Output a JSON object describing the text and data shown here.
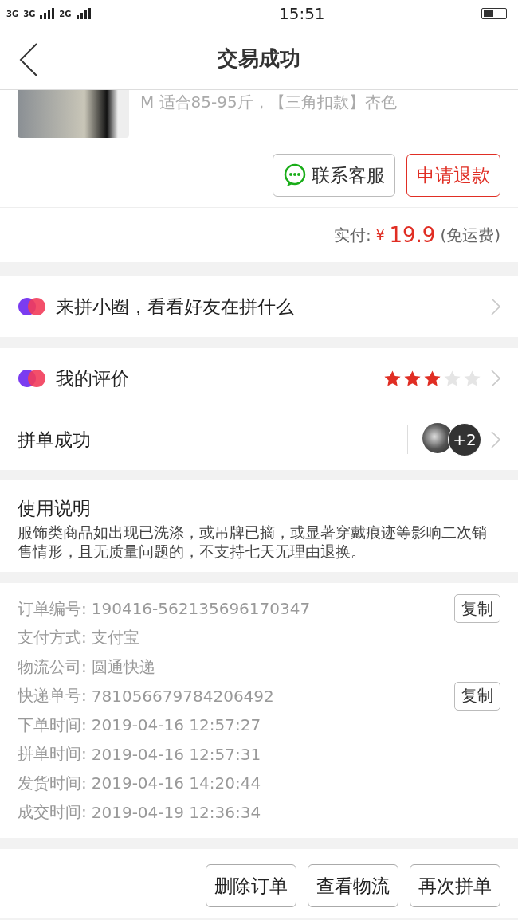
{
  "status_bar": {
    "network_1": "3G",
    "network_2": "3G",
    "network_3": "2G",
    "time": "15:51"
  },
  "header": {
    "title": "交易成功"
  },
  "product": {
    "spec": "M 适合85-95斤，【三角扣款】杏色"
  },
  "product_actions": [
    {
      "label": "联系客服",
      "kind": "chat"
    },
    {
      "label": "申请退款",
      "kind": "primary"
    }
  ],
  "payment": {
    "label": "实付:",
    "currency": "¥",
    "amount": "19.9",
    "note": "(免运费)"
  },
  "circle_row": {
    "label": "来拼小圈，看看好友在拼什么"
  },
  "review_row": {
    "label": "我的评价",
    "stars": 3
  },
  "group_row": {
    "label": "拼单成功",
    "extra_count": "+2"
  },
  "usage": {
    "title": "使用说明",
    "text": "服饰类商品如出现已洗涤，或吊牌已摘，或显著穿戴痕迹等影响二次销售情形，且无质量问题的，不支持七天无理由退换。"
  },
  "order_info": [
    {
      "label": "订单编号:",
      "value": "190416-562135696170347",
      "copy": "复制"
    },
    {
      "label": "支付方式:",
      "value": "支付宝"
    },
    {
      "label": "物流公司:",
      "value": "圆通快递"
    },
    {
      "label": "快递单号:",
      "value": "781056679784206492",
      "copy": "复制"
    },
    {
      "label": "下单时间:",
      "value": "2019-04-16 12:57:27"
    },
    {
      "label": "拼单时间:",
      "value": "2019-04-16 12:57:31"
    },
    {
      "label": "发货时间:",
      "value": "2019-04-16 14:20:44"
    },
    {
      "label": "成交时间:",
      "value": "2019-04-19 12:36:34"
    }
  ],
  "bottom_actions": [
    "删除订单",
    "查看物流",
    "再次拼单"
  ]
}
